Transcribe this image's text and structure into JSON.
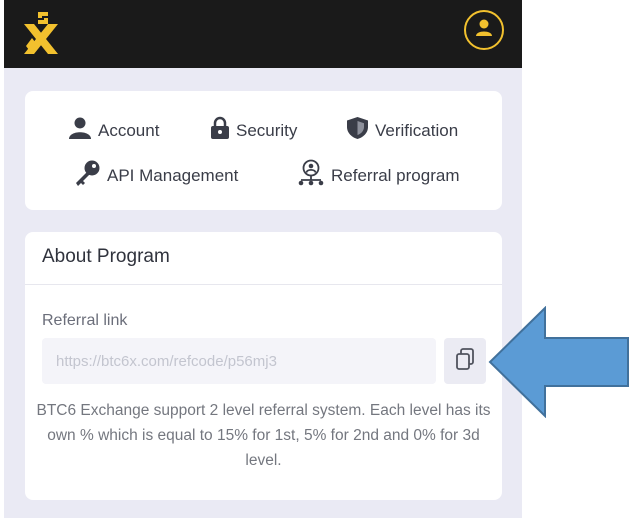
{
  "header": {
    "logo_icon": "btc6x-logo-icon",
    "profile_icon": "user-avatar-icon",
    "accent_color": "#f2c12e",
    "background_color": "#1a1a1a"
  },
  "nav": {
    "items": [
      {
        "label": "Account",
        "icon": "user-icon"
      },
      {
        "label": "Security",
        "icon": "lock-icon"
      },
      {
        "label": "Verification",
        "icon": "shield-icon"
      },
      {
        "label": "API Management",
        "icon": "key-icon"
      },
      {
        "label": "Referral program",
        "icon": "referral-network-icon"
      }
    ]
  },
  "about": {
    "title": "About Program",
    "referral_label": "Referral link",
    "referral_value": "https://btc6x.com/refcode/p56mj3",
    "copy_icon": "copy-icon",
    "description": "BTC6 Exchange support 2 level referral system. Each level has its own % which is equal to 15% for 1st, 5% for 2nd and 0% for 3d level."
  },
  "annotation": {
    "icon": "arrow-left-icon",
    "color": "#5b9bd5"
  }
}
